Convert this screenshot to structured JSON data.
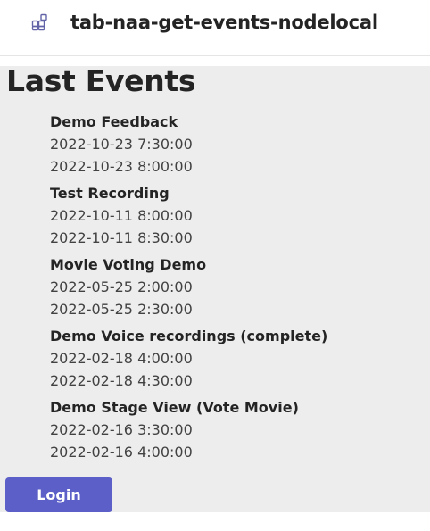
{
  "header": {
    "app_icon": "apps-icon",
    "title": "tab-naa-get-events-nodelocal"
  },
  "main": {
    "heading": "Last Events",
    "events": [
      {
        "title": "Demo Feedback",
        "start": "2022-10-23 7:30:00",
        "end": "2022-10-23 8:00:00"
      },
      {
        "title": "Test Recording",
        "start": "2022-10-11 8:00:00",
        "end": "2022-10-11 8:30:00"
      },
      {
        "title": "Movie Voting Demo",
        "start": "2022-05-25 2:00:00",
        "end": "2022-05-25 2:30:00"
      },
      {
        "title": "Demo Voice recordings (complete)",
        "start": "2022-02-18 4:00:00",
        "end": "2022-02-18 4:30:00"
      },
      {
        "title": "Demo Stage View (Vote Movie)",
        "start": "2022-02-16 3:30:00",
        "end": "2022-02-16 4:00:00"
      }
    ],
    "login_label": "Login"
  },
  "colors": {
    "accent": "#5b5fc7",
    "content_background": "#ededed"
  }
}
